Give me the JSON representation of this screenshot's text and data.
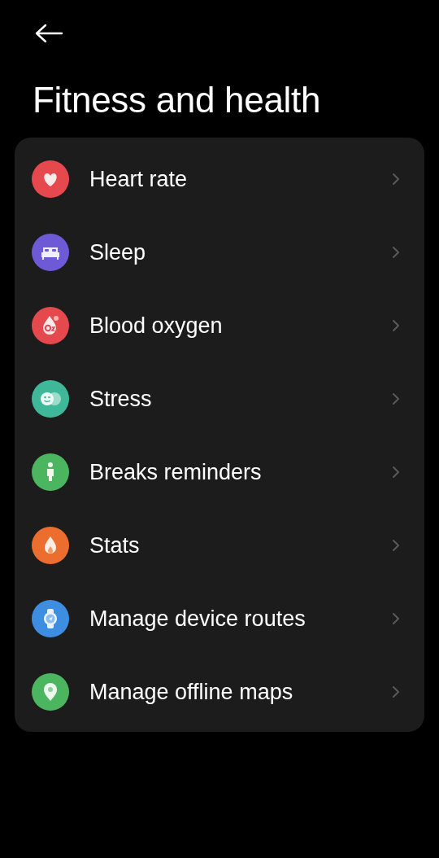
{
  "title": "Fitness and health",
  "items": [
    {
      "label": "Heart rate",
      "kind": "heart",
      "color": "#e5484d"
    },
    {
      "label": "Sleep",
      "kind": "bed",
      "color": "#6e5ad6"
    },
    {
      "label": "Blood oxygen",
      "kind": "oxygen",
      "color": "#e5484d"
    },
    {
      "label": "Stress",
      "kind": "faces",
      "color": "#3fb89a"
    },
    {
      "label": "Breaks reminders",
      "kind": "person",
      "color": "#4cb560"
    },
    {
      "label": "Stats",
      "kind": "flame",
      "color": "#ec6e2e"
    },
    {
      "label": "Manage device routes",
      "kind": "watch",
      "color": "#3d8ee0"
    },
    {
      "label": "Manage offline maps",
      "kind": "pin",
      "color": "#4cb560"
    }
  ]
}
